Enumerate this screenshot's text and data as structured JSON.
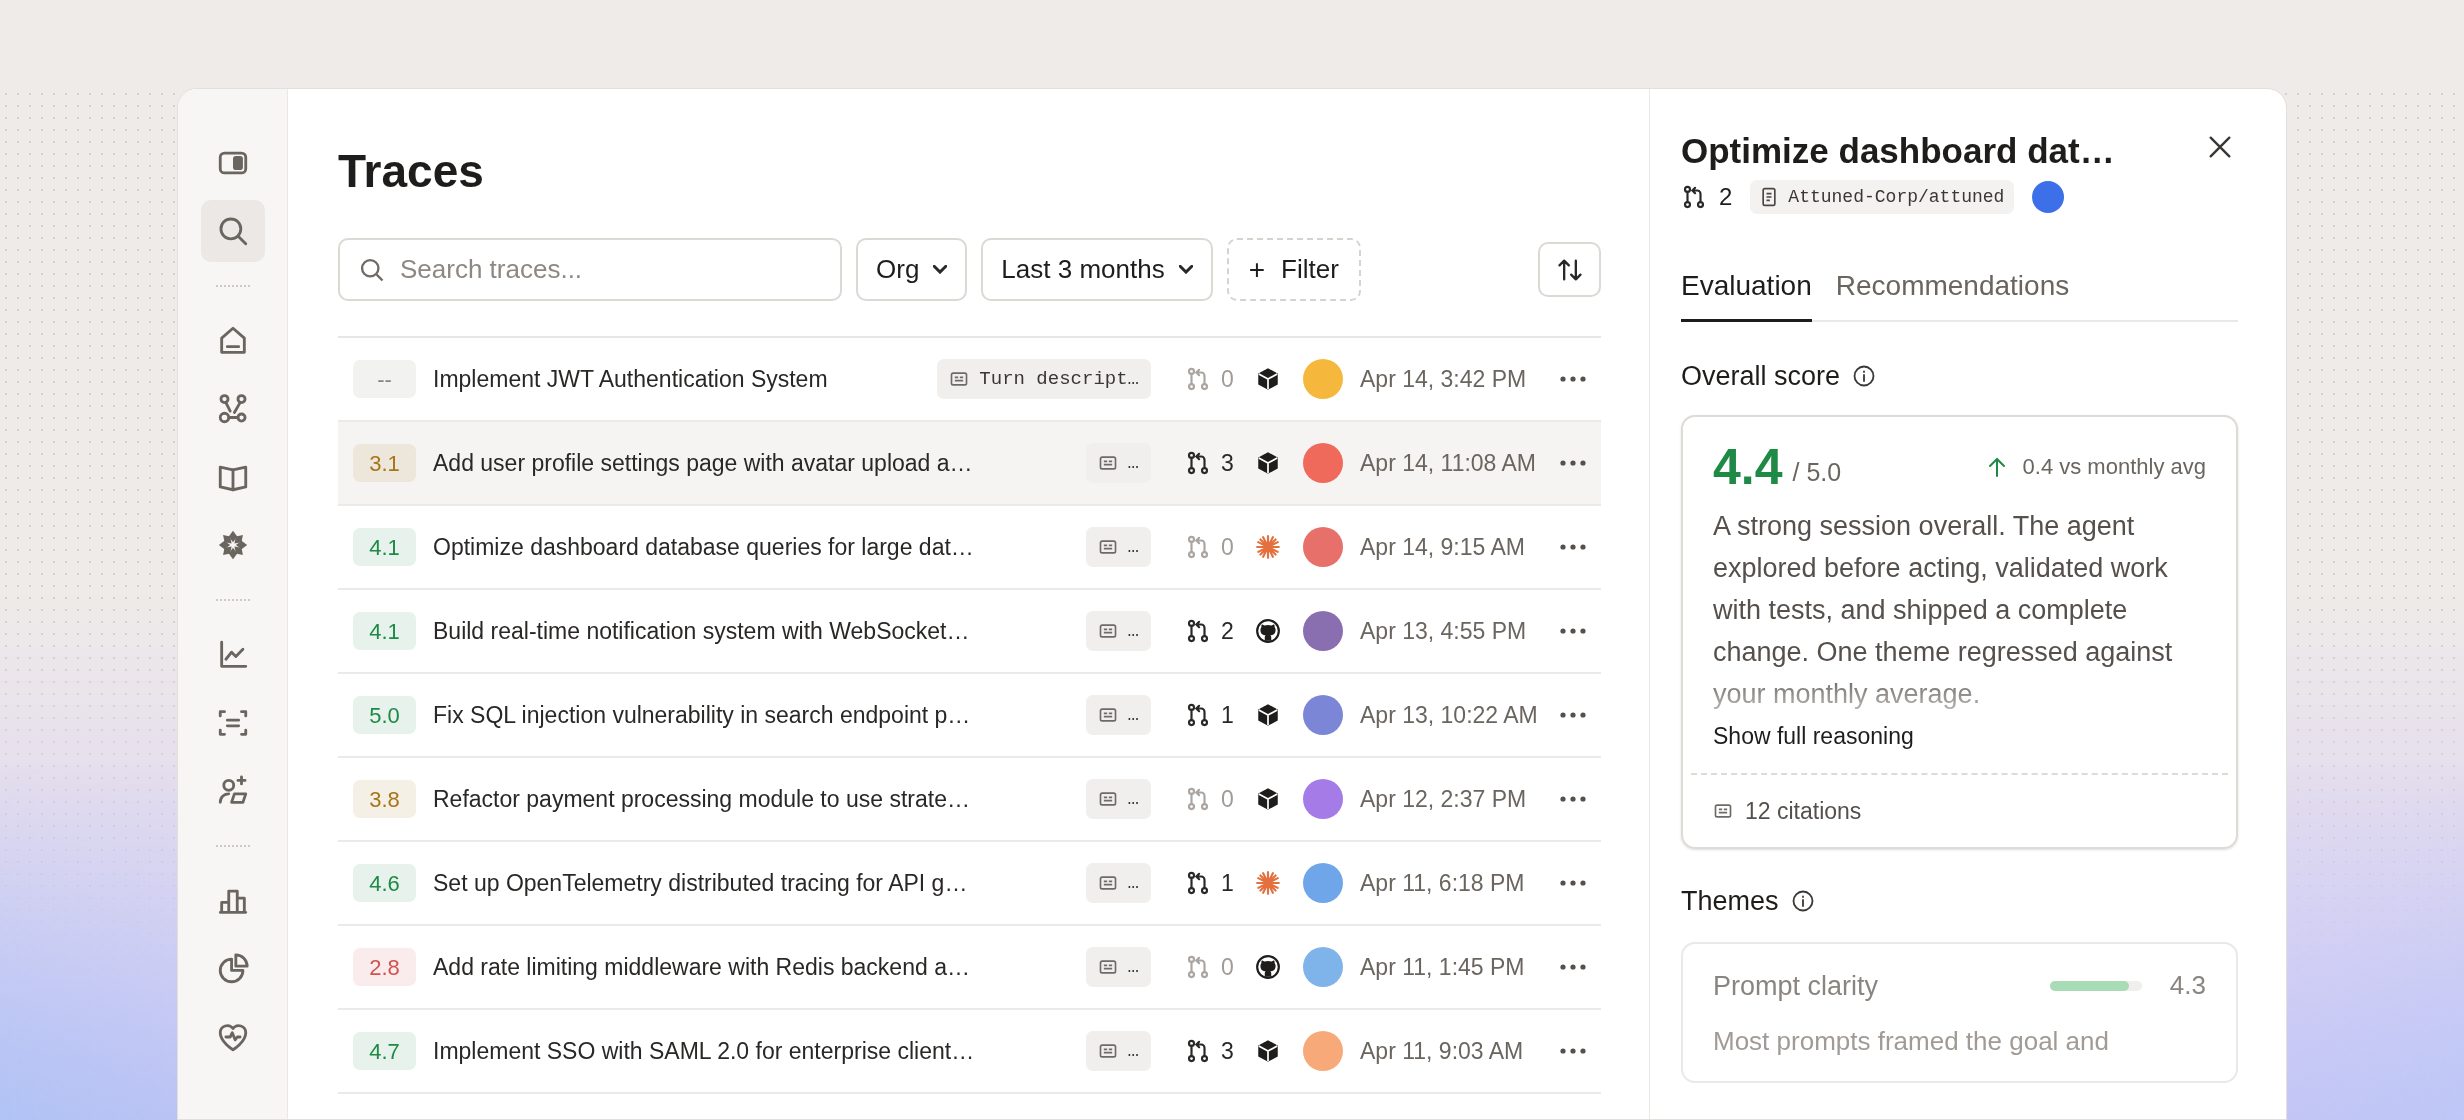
{
  "sidebar": {
    "groups": [
      [
        {
          "kind": "panel",
          "selected": false
        },
        {
          "kind": "search",
          "selected": true
        }
      ],
      [
        {
          "kind": "home",
          "selected": false
        },
        {
          "kind": "nodes",
          "selected": false
        },
        {
          "kind": "book",
          "selected": false
        },
        {
          "kind": "flower",
          "selected": false
        }
      ],
      [
        {
          "kind": "chart",
          "selected": false
        },
        {
          "kind": "scan",
          "selected": false
        },
        {
          "kind": "person",
          "selected": false
        }
      ],
      [
        {
          "kind": "bars",
          "selected": false
        },
        {
          "kind": "pie",
          "selected": false
        },
        {
          "kind": "heart",
          "selected": false
        }
      ]
    ]
  },
  "page": {
    "title": "Traces"
  },
  "toolbar": {
    "search": {
      "placeholder": "Search traces..."
    },
    "org": "Org",
    "range": "Last 3 months",
    "filter_icon": "+",
    "filter": "Filter"
  },
  "table": {
    "rows": [
      {
        "score": {
          "text": "--",
          "color": "#8a8580"
        },
        "title": "Implement JWT Authentication System",
        "tag": "Turn descript…",
        "pr_count": "0",
        "pr_active": false,
        "source": {
          "kind": "cube"
        },
        "avatar": {
          "color": "#f5b83d"
        },
        "date": "Apr 14, 3:42 PM",
        "selected": false
      },
      {
        "score": {
          "text": "3.1",
          "color": "#a8741a"
        },
        "title": "Add user profile settings page with avatar upload a…",
        "tag": "…",
        "pr_count": "3",
        "pr_active": true,
        "source": {
          "kind": "cube"
        },
        "avatar": {
          "color": "#f06a5c"
        },
        "date": "Apr 14, 11:08 AM",
        "selected": true
      },
      {
        "score": {
          "text": "4.1",
          "color": "#1f8a45"
        },
        "title": "Optimize dashboard database queries for large dat…",
        "tag": "…",
        "pr_count": "0",
        "pr_active": false,
        "source": {
          "kind": "spark"
        },
        "avatar": {
          "color": "#e8706a"
        },
        "date": "Apr 14, 9:15 AM",
        "selected": false
      },
      {
        "score": {
          "text": "4.1",
          "color": "#1f8a45"
        },
        "title": "Build real-time notification system with WebSocket…",
        "tag": "…",
        "pr_count": "2",
        "pr_active": true,
        "source": {
          "kind": "github"
        },
        "avatar": {
          "color": "#8a6fb0"
        },
        "date": "Apr 13, 4:55 PM",
        "selected": false
      },
      {
        "score": {
          "text": "5.0",
          "color": "#1f8a45"
        },
        "title": "Fix SQL injection vulnerability in search endpoint p…",
        "tag": "…",
        "pr_count": "1",
        "pr_active": true,
        "source": {
          "kind": "cube"
        },
        "avatar": {
          "color": "#7b86d6"
        },
        "date": "Apr 13, 10:22 AM",
        "selected": false
      },
      {
        "score": {
          "text": "3.8",
          "color": "#a8741a"
        },
        "title": "Refactor payment processing module to use strate…",
        "tag": "…",
        "pr_count": "0",
        "pr_active": false,
        "source": {
          "kind": "cube"
        },
        "avatar": {
          "color": "#a57be8"
        },
        "date": "Apr 12, 2:37 PM",
        "selected": false
      },
      {
        "score": {
          "text": "4.6",
          "color": "#1f8a45"
        },
        "title": "Set up OpenTelemetry distributed tracing for API g…",
        "tag": "…",
        "pr_count": "1",
        "pr_active": true,
        "source": {
          "kind": "spark"
        },
        "avatar": {
          "color": "#6fa6ea"
        },
        "date": "Apr 11, 6:18 PM",
        "selected": false
      },
      {
        "score": {
          "text": "2.8",
          "color": "#d0534f"
        },
        "title": "Add rate limiting middleware with Redis backend a…",
        "tag": "…",
        "pr_count": "0",
        "pr_active": false,
        "source": {
          "kind": "github"
        },
        "avatar": {
          "color": "#7fb4ea"
        },
        "date": "Apr 11, 1:45 PM",
        "selected": false
      },
      {
        "score": {
          "text": "4.7",
          "color": "#1f8a45"
        },
        "title": "Implement SSO with SAML 2.0 for enterprise client…",
        "tag": "…",
        "pr_count": "3",
        "pr_active": true,
        "source": {
          "kind": "cube"
        },
        "avatar": {
          "color": "#f7a97a"
        },
        "date": "Apr 11, 9:03 AM",
        "selected": false
      }
    ]
  },
  "detail": {
    "title": "Optimize dashboard dat…",
    "pr_count": "2",
    "repo": "Attuned-Corp/attuned",
    "avatar": {
      "color": "#3d6fe8"
    },
    "tabs": [
      {
        "label": "Evaluation",
        "selected": true
      },
      {
        "label": "Recommendations",
        "selected": false
      }
    ],
    "overall": {
      "heading": "Overall score",
      "score": "4.4",
      "out_of": "/ 5.0",
      "delta": "0.4 vs monthly avg",
      "summary": "A strong session overall. The agent explored before acting, validated work with tests, and shipped a complete change. One theme regressed against your monthly average.",
      "more": "Show full reasoning",
      "citations": "12 citations"
    },
    "themes": {
      "heading": "Themes",
      "items": [
        {
          "name": "Prompt clarity",
          "level": 0.86,
          "score": "4.3",
          "text": "Most prompts framed the goal and"
        }
      ]
    }
  }
}
